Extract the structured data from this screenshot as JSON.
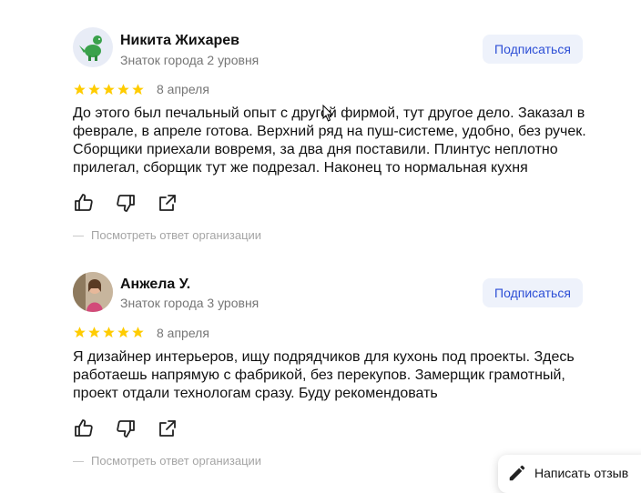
{
  "reviews": [
    {
      "author": "Никита Жихарев",
      "level": "Знаток города 2 уровня",
      "subscribe_label": "Подписаться",
      "rating": 5,
      "date": "8 апреля",
      "text": "До этого был печальный опыт с другой фирмой, тут другое дело. Заказал в феврале, в апреле готова. Верхний ряд на пуш-системе, удобно, без ручек. Сборщики приехали вовремя, за два дня поставили. Плинтус неплотно прилегал, сборщик тут же подрезал. Наконец то нормальная кухня",
      "answer_link": "Посмотреть ответ организации"
    },
    {
      "author": "Анжела У.",
      "level": "Знаток города 3 уровня",
      "subscribe_label": "Подписаться",
      "rating": 5,
      "date": "8 апреля",
      "text": "Я дизайнер интерьеров, ищу подрядчиков для кухонь под проекты. Здесь работаешь напрямую с фабрикой, без перекупов. Замерщик грамотный, проект отдали технологам сразу. Буду рекомендовать",
      "answer_link": "Посмотреть ответ организации"
    }
  ],
  "write_review_label": "Написать отзыв",
  "colors": {
    "star": "#ffcc00",
    "accent": "#2d4fd6",
    "muted": "#767676"
  }
}
